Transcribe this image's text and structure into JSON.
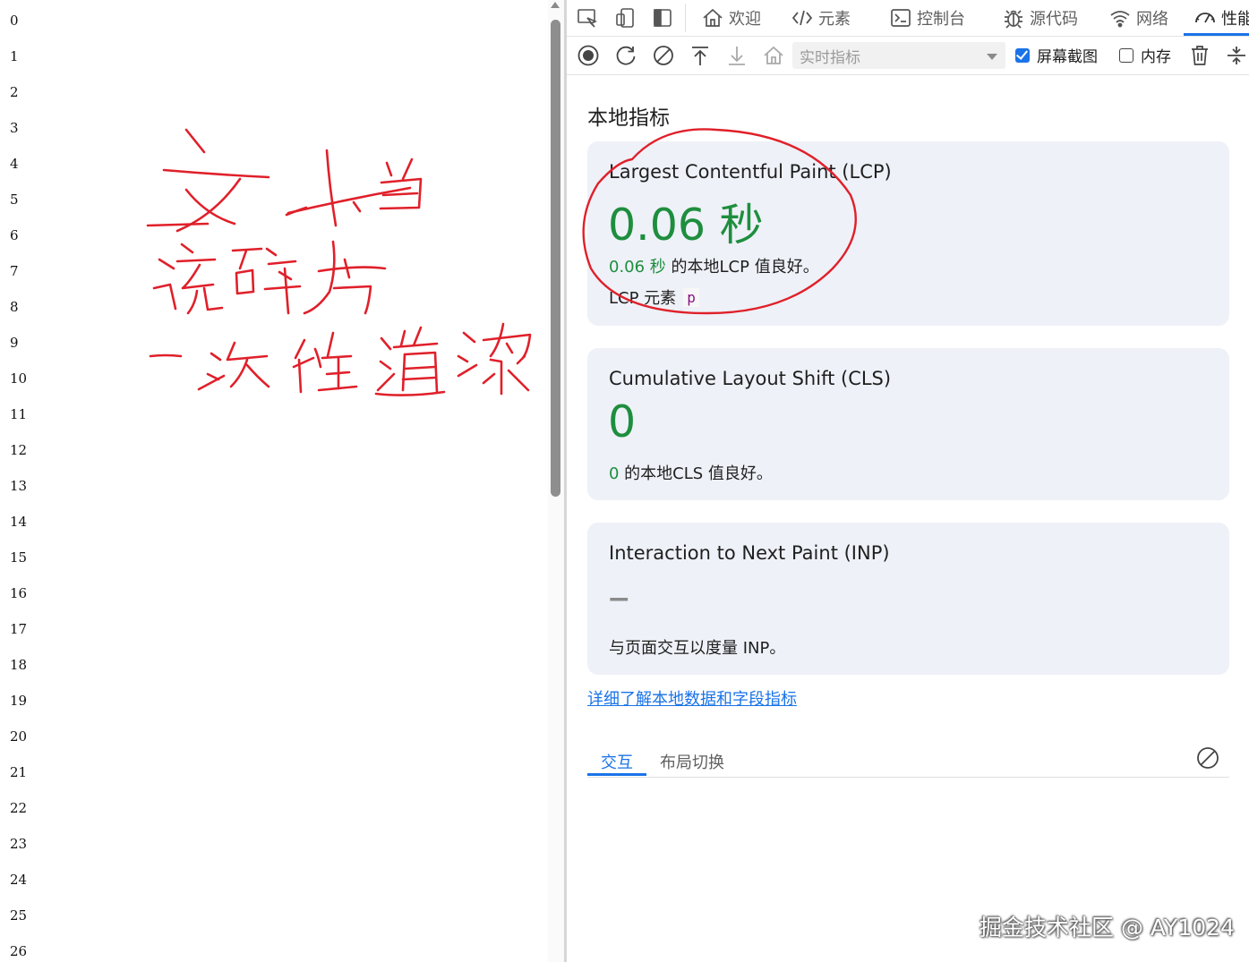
{
  "page": {
    "line_numbers": [
      "0",
      "1",
      "2",
      "3",
      "4",
      "5",
      "6",
      "7",
      "8",
      "9",
      "10",
      "11",
      "12",
      "13",
      "14",
      "15",
      "16",
      "17",
      "18",
      "19",
      "20",
      "21",
      "22",
      "23",
      "24",
      "25",
      "26"
    ],
    "handwriting_lines": [
      "文本节点",
      "碎片",
      "一次性渲染"
    ]
  },
  "devtools": {
    "tabs": [
      {
        "label": "欢迎",
        "icon": "home-icon"
      },
      {
        "label": "元素",
        "icon": "code-icon"
      },
      {
        "label": "控制台",
        "icon": "console-icon"
      },
      {
        "label": "源代码",
        "icon": "bug-icon"
      },
      {
        "label": "网络",
        "icon": "wifi-icon"
      },
      {
        "label": "性能",
        "icon": "gauge-icon",
        "active": true
      }
    ],
    "toolbar": {
      "throttle_value": "实时指标",
      "screenshots_label": "屏幕截图",
      "screenshots_checked": true,
      "memory_label": "内存",
      "memory_checked": false
    },
    "section_title": "本地指标",
    "metrics": {
      "lcp": {
        "title": "Largest Contentful Paint (LCP)",
        "value": "0.06 秒",
        "desc_value": "0.06 秒",
        "desc_text": " 的本地LCP 值良好。",
        "element_label": "LCP 元素",
        "element_tag": "p"
      },
      "cls": {
        "title": "Cumulative Layout Shift (CLS)",
        "value": "0",
        "desc_value": "0",
        "desc_text": " 的本地CLS 值良好。"
      },
      "inp": {
        "title": "Interaction to Next Paint (INP)",
        "value": "–",
        "desc_text": "与页面交互以度量 INP。"
      }
    },
    "learn_link": "详细了解本地数据和字段指标",
    "subtabs": [
      "交互",
      "布局切换"
    ]
  },
  "watermark": "掘金技术社区 @ AY1024",
  "colors": {
    "accent": "#1a73e8",
    "good": "#1e8e3e",
    "card_bg": "#eef1f7",
    "annotation": "#e0202a"
  }
}
